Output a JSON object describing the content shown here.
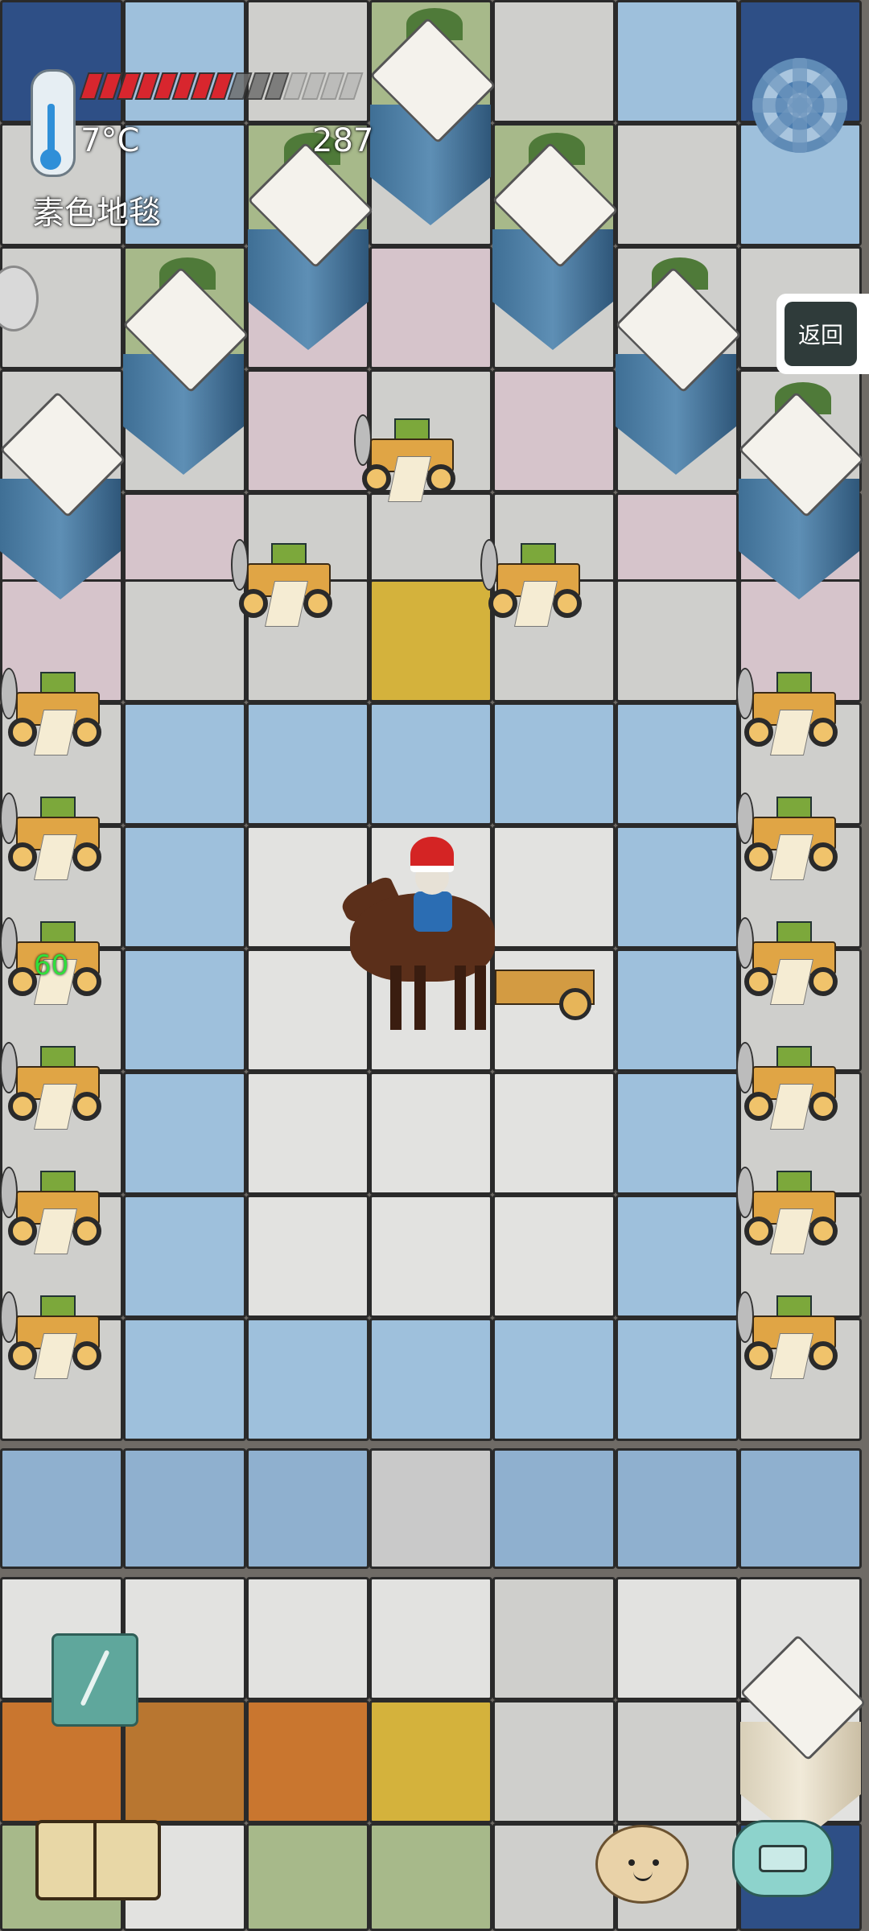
{
  "hud": {
    "temperature": "7°C",
    "tile_name": "素色地毯",
    "score": "287",
    "health": {
      "filled": 8,
      "total": 15
    },
    "back_label": "返回",
    "side_number": "60"
  },
  "icons": {
    "thermometer": "thermometer-icon",
    "settings": "gear-icon",
    "pencil": "pencil-icon",
    "journal": "book-icon",
    "emote": "potato-face-icon",
    "chat": "keyboard-icon"
  },
  "colors": {
    "health_fill": "#d8262e",
    "side_number": "#2fe03a",
    "back_button_bg": "#2f3b3a"
  }
}
